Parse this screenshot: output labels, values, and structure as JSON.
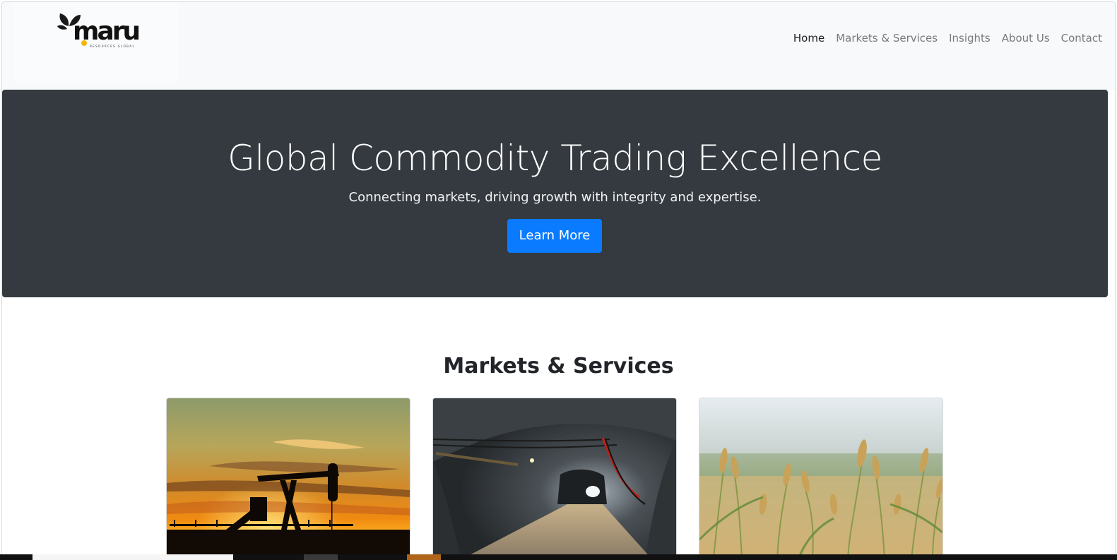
{
  "brand": {
    "name": "maru",
    "tagline": "RESOURCES GLOBAL",
    "accent_color": "#f2b705"
  },
  "nav": {
    "items": [
      {
        "label": "Home",
        "active": true
      },
      {
        "label": "Markets & Services",
        "active": false
      },
      {
        "label": "Insights",
        "active": false
      },
      {
        "label": "About Us",
        "active": false
      },
      {
        "label": "Contact",
        "active": false
      }
    ]
  },
  "hero": {
    "title": "Global Commodity Trading Excellence",
    "subtitle": "Connecting markets, driving growth with integrity and expertise.",
    "cta_label": "Learn More",
    "background_color": "#343a40",
    "button_color": "#0a7bff"
  },
  "markets": {
    "title": "Markets & Services",
    "cards": [
      {
        "image": "oil-pumpjack-sunset-photo"
      },
      {
        "image": "mine-tunnel-photo"
      },
      {
        "image": "wheat-field-photo"
      }
    ]
  }
}
